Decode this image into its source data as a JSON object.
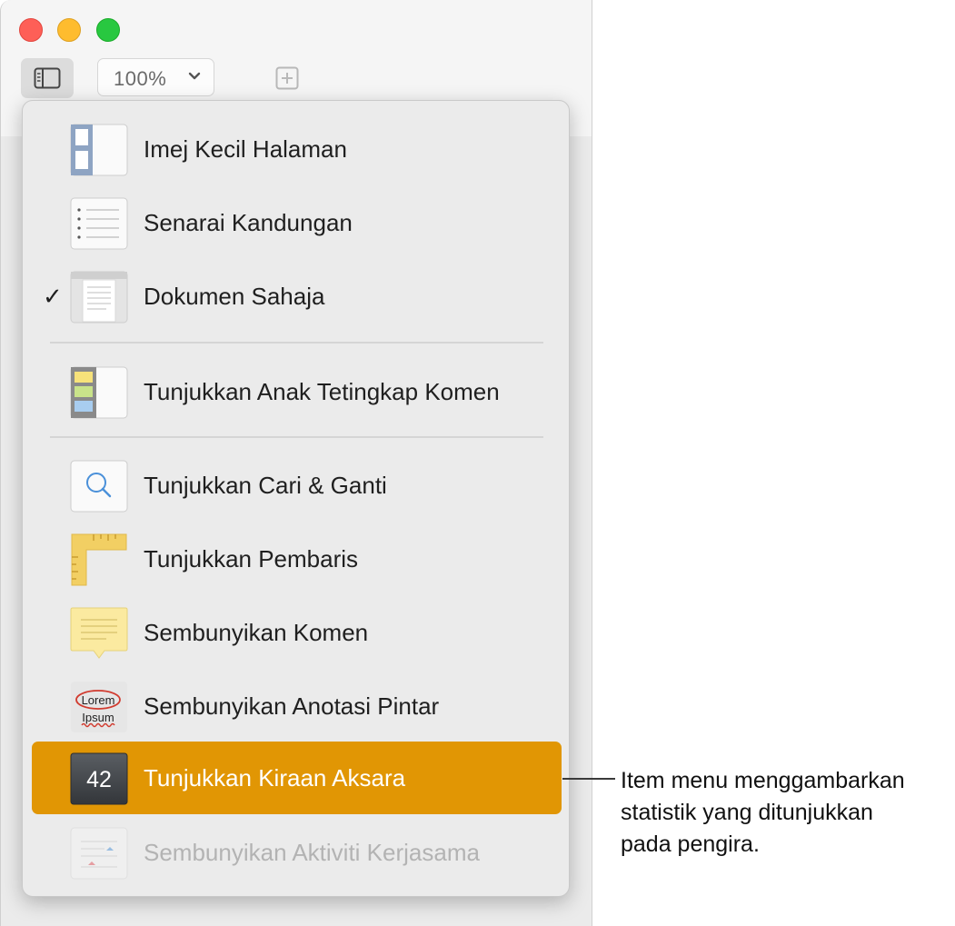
{
  "toolbar": {
    "zoom_value": "100%"
  },
  "menu": {
    "items": [
      {
        "label": "Imej Kecil Halaman",
        "icon": "page-thumbnails-icon"
      },
      {
        "label": "Senarai Kandungan",
        "icon": "table-of-contents-icon"
      },
      {
        "label": "Dokumen Sahaja",
        "icon": "document-only-icon",
        "checked": true,
        "check_mark": "✓"
      },
      {
        "label": "Tunjukkan Anak Tetingkap Komen",
        "icon": "comments-pane-icon"
      },
      {
        "label": "Tunjukkan Cari & Ganti",
        "icon": "find-replace-icon"
      },
      {
        "label": "Tunjukkan Pembaris",
        "icon": "ruler-icon"
      },
      {
        "label": "Sembunyikan Komen",
        "icon": "comment-note-icon"
      },
      {
        "label": "Sembunyikan Anotasi Pintar",
        "icon": "smart-annotation-icon",
        "icon_text_1": "Lorem",
        "icon_text_2": "Ipsum"
      },
      {
        "label": "Tunjukkan Kiraan Aksara",
        "icon": "character-count-icon",
        "icon_text": "42",
        "highlighted": true
      },
      {
        "label": "Sembunyikan Aktiviti Kerjasama",
        "icon": "collaboration-activity-icon",
        "disabled": true
      }
    ]
  },
  "callout": {
    "lines": [
      "Item menu menggambarkan",
      "statistik yang ditunjukkan",
      "pada pengira."
    ]
  },
  "colors": {
    "highlight": "#e19604",
    "menu_background": "#ebebeb",
    "disabled_text": "#b3b3b3"
  }
}
